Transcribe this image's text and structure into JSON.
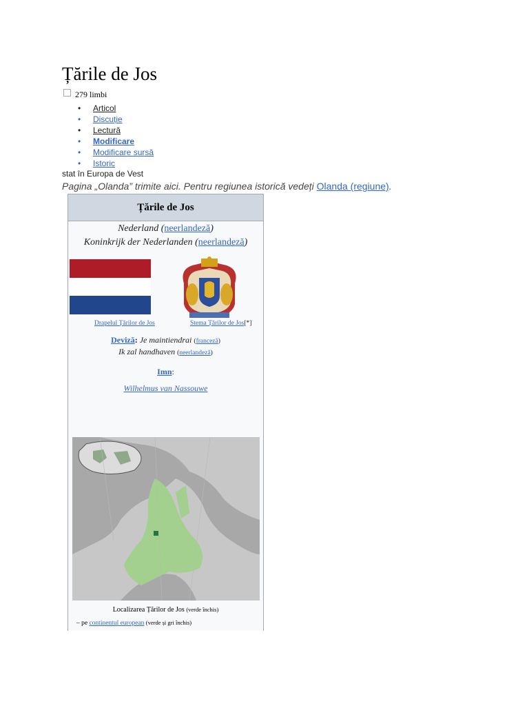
{
  "page": {
    "title": "Țările de Jos",
    "languages": "279 limbi",
    "menu": [
      {
        "label": "Articol"
      },
      {
        "label": "Discuție"
      },
      {
        "label": "Lectură"
      },
      {
        "label": "Modificare"
      },
      {
        "label": "Modificare sursă"
      },
      {
        "label": "Istoric"
      }
    ],
    "description": "stat în Europa de Vest",
    "hatnote_prefix": "Pagina „Olanda” trimite aici. Pentru regiunea istorică vedeți ",
    "hatnote_link": "Olanda (regiune)",
    "hatnote_suffix": "."
  },
  "infobox": {
    "header": "Țările de Jos",
    "native_name_1": "Nederland",
    "native_lang_1": "neerlandeză",
    "native_name_2": "Koninkrijk der Nederlanden",
    "native_lang_2": "neerlandeză",
    "flag_caption": "Drapelul Țărilor de Jos",
    "coat_caption": "Stema Țărilor de Jos",
    "coat_note": "[*]",
    "motto_label": "Deviză",
    "motto_text": "Je maintiendrai",
    "motto_lang": "franceză",
    "motto2_text": "Ik zal handhaven",
    "motto2_lang": "neerlandeză",
    "anthem_label": "Imn",
    "anthem_text": "Wilhelmus van Nassouwe",
    "location_caption": "Localizarea Țărilor de Jos",
    "location_note": "(verde închis)",
    "location2_prefix": "– pe ",
    "location2_link": "continentul european",
    "location2_note": "(verde și gri închis)",
    "colors": {
      "flag_red": "#ae1c28",
      "flag_white": "#ffffff",
      "flag_blue": "#21468b",
      "eu_green": "#a3d08e",
      "nl_green": "#1d7a3a",
      "land_grey": "#c8c8c8",
      "sea_grey": "#9e9e9e"
    }
  }
}
